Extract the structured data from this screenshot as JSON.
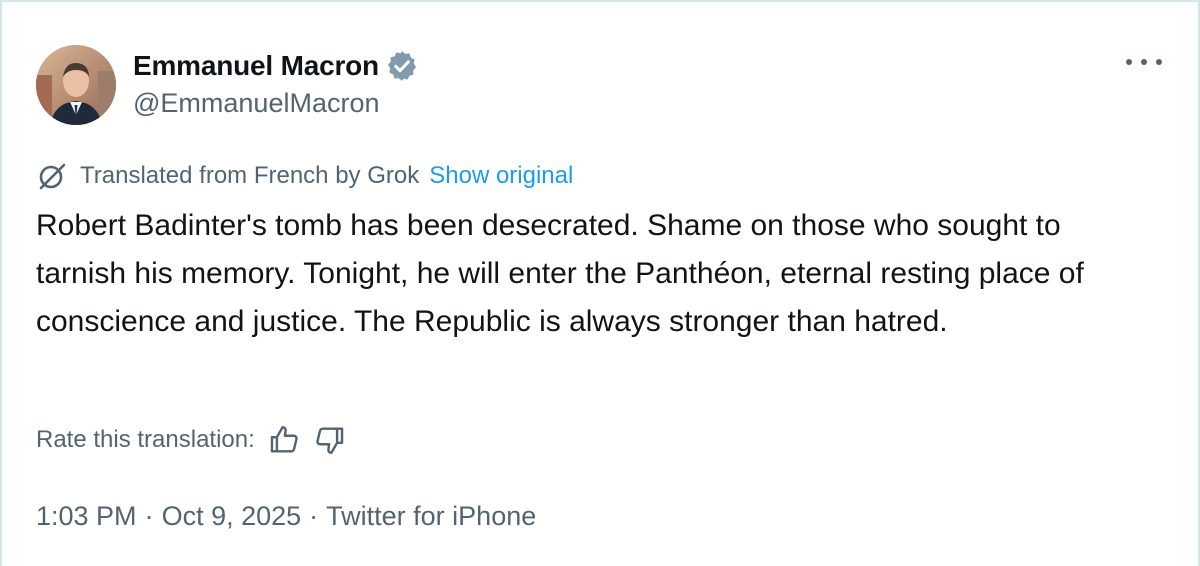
{
  "author": {
    "name": "Emmanuel Macron",
    "handle": "@EmmanuelMacron",
    "verified_color": "#829aab"
  },
  "translation": {
    "label": "Translated from French by Grok",
    "show_original": "Show original"
  },
  "tweet": {
    "text": "Robert Badinter's tomb has been desecrated. Shame on those who sought to tarnish his memory. Tonight, he will enter the Panthéon, eternal resting place of conscience and justice. The Republic is always stronger than hatred."
  },
  "rating": {
    "label": "Rate this translation:"
  },
  "meta": {
    "time": "1:03 PM",
    "date": "Oct 9, 2025",
    "separator": "·",
    "source": "Twitter for iPhone"
  },
  "colors": {
    "link": "#1d9bf0",
    "secondary": "#536471",
    "primary": "#0f1419"
  }
}
